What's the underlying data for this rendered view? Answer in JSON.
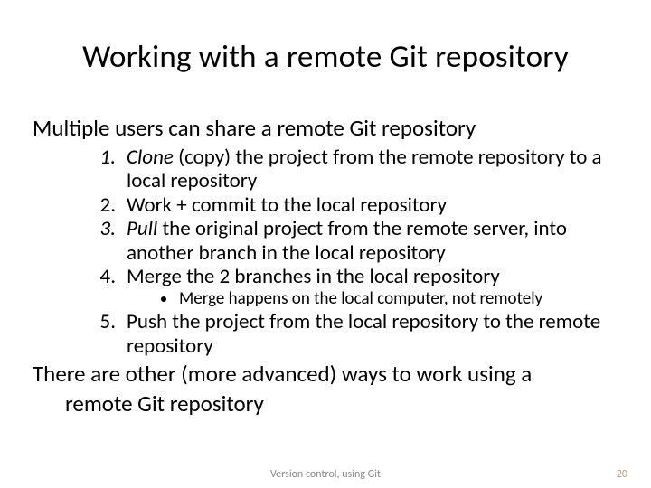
{
  "title": "Working with a remote Git repository",
  "intro": "Multiple users can share a remote Git repository",
  "steps": [
    {
      "pre_italic": "Clone",
      "rest": " (copy) the project from the remote repository to a local repository",
      "marker_italic": true
    },
    {
      "pre_italic": "",
      "rest": "Work + commit to the local repository",
      "marker_italic": false
    },
    {
      "pre_italic": "Pull",
      "rest": " the original project from the remote server, into another branch in the local repository",
      "marker_italic": true
    },
    {
      "pre_italic": "",
      "rest": "Merge the 2 branches in the local repository",
      "marker_italic": false
    },
    {
      "pre_italic": "",
      "rest": "Push the project from the local repository to the remote repository",
      "marker_italic": false
    }
  ],
  "sub_note": "Merge happens on the local computer, not remotely",
  "closing_a": "There are other (more advanced) ways to work using a",
  "closing_b": "remote Git repository",
  "footer_center": "Version control, using Git",
  "footer_page": "20"
}
